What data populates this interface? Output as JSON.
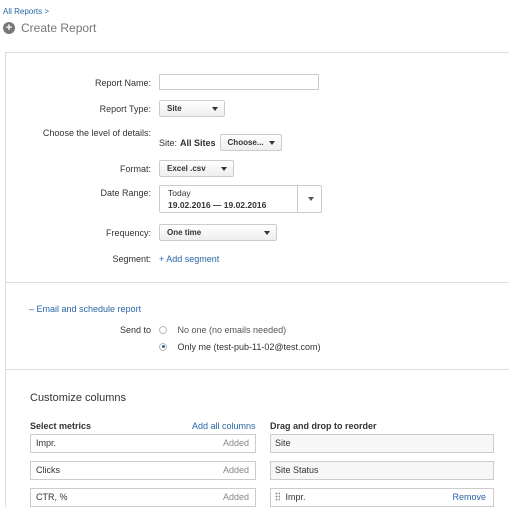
{
  "breadcrumb": "All Reports >",
  "page_title": "Create Report",
  "form": {
    "report_name": {
      "label": "Report Name:",
      "value": ""
    },
    "report_type": {
      "label": "Report Type:",
      "value": "Site"
    },
    "details": {
      "label": "Choose the level of details:",
      "site_prefix": "Site:",
      "site_value": "All Sites",
      "choose_value": "Choose..."
    },
    "format": {
      "label": "Format:",
      "value": "Excel .csv"
    },
    "date_range": {
      "label": "Date Range:",
      "preset": "Today",
      "range": "19.02.2016 — 19.02.2016"
    },
    "frequency": {
      "label": "Frequency:",
      "value": "One time"
    },
    "segment": {
      "label": "Segment:",
      "link": "+ Add segment"
    }
  },
  "email": {
    "toggle": "– Email and schedule report",
    "send_to_label": "Send to",
    "options": [
      {
        "label": "No one (no emails needed)",
        "checked": false
      },
      {
        "label": "Only me (test-pub-11-02@test.com)",
        "checked": true
      }
    ]
  },
  "columns": {
    "title": "Customize columns",
    "select_metrics": "Select metrics",
    "add_all": "Add all columns",
    "reorder_title": "Drag and drop to reorder",
    "metrics": [
      {
        "name": "Impr.",
        "status": "Added"
      },
      {
        "name": "Clicks",
        "status": "Added"
      },
      {
        "name": "CTR, %",
        "status": "Added"
      }
    ],
    "order": [
      {
        "name": "Site",
        "removable": false
      },
      {
        "name": "Site Status",
        "removable": false
      },
      {
        "name": "Impr.",
        "removable": true,
        "remove_label": "Remove"
      }
    ]
  }
}
